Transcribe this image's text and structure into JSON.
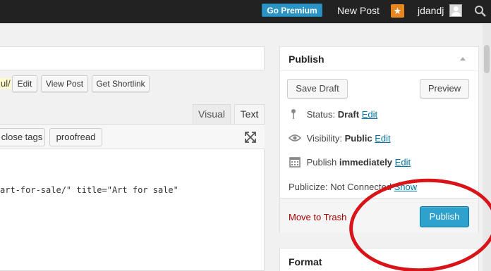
{
  "adminbar": {
    "go_premium": "Go Premium",
    "new_post": "New Post",
    "username": "jdandj"
  },
  "editor": {
    "permalink_tail": "ul/",
    "buttons": {
      "edit": "Edit",
      "view_post": "View Post",
      "get_shortlink": "Get Shortlink"
    },
    "tabs": {
      "visual": "Visual",
      "text": "Text"
    },
    "quicktags": {
      "close_tags": "close tags",
      "proofread": "proofread"
    },
    "code_line": "art-for-sale/\" title=\"Art for sale\""
  },
  "publish_box": {
    "title": "Publish",
    "save_draft": "Save Draft",
    "preview": "Preview",
    "status_label": "Status:",
    "status_value": "Draft",
    "status_edit": "Edit",
    "visibility_label": "Visibility:",
    "visibility_value": "Public",
    "visibility_edit": "Edit",
    "publish_label": "Publish",
    "publish_value": "immediately",
    "publish_edit": "Edit",
    "publicize_label": "Publicize: Not Connected",
    "publicize_show": "Show",
    "move_to_trash": "Move to Trash",
    "publish_button": "Publish"
  },
  "format_box": {
    "title": "Format"
  },
  "colors": {
    "admin_bar": "#222222",
    "accent": "#2ea2cc",
    "trash": "#aa0000",
    "annotation": "#d8141a"
  }
}
